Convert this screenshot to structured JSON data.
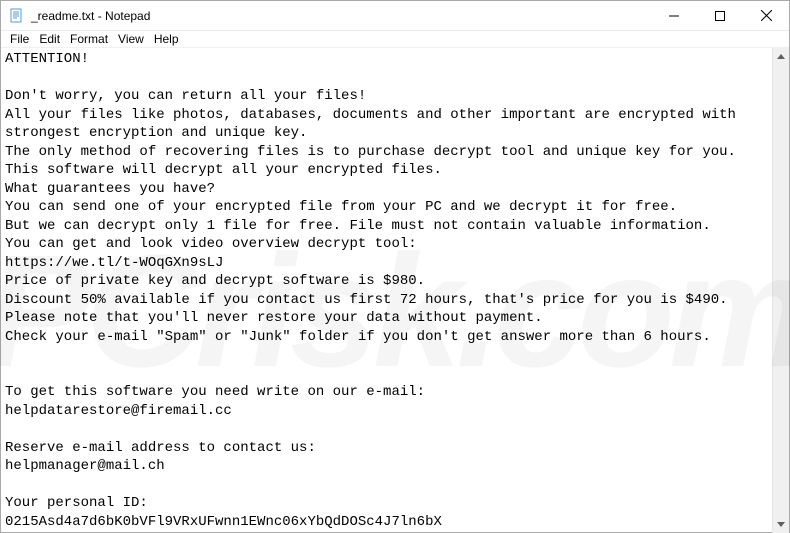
{
  "window": {
    "title": "_readme.txt - Notepad"
  },
  "menu": {
    "file": "File",
    "edit": "Edit",
    "format": "Format",
    "view": "View",
    "help": "Help"
  },
  "body_text": "ATTENTION!\n\nDon't worry, you can return all your files!\nAll your files like photos, databases, documents and other important are encrypted with strongest encryption and unique key.\nThe only method of recovering files is to purchase decrypt tool and unique key for you.\nThis software will decrypt all your encrypted files.\nWhat guarantees you have?\nYou can send one of your encrypted file from your PC and we decrypt it for free.\nBut we can decrypt only 1 file for free. File must not contain valuable information.\nYou can get and look video overview decrypt tool:\nhttps://we.tl/t-WOqGXn9sLJ\nPrice of private key and decrypt software is $980.\nDiscount 50% available if you contact us first 72 hours, that's price for you is $490.\nPlease note that you'll never restore your data without payment.\nCheck your e-mail \"Spam\" or \"Junk\" folder if you don't get answer more than 6 hours.\n\n\nTo get this software you need write on our e-mail:\nhelpdatarestore@firemail.cc\n\nReserve e-mail address to contact us:\nhelpmanager@mail.ch\n\nYour personal ID:\n0215Asd4a7d6bK0bVFl9VRxUFwnn1EWnc06xYbQdDOSc4J7ln6bX",
  "watermark": "PCrisk.com"
}
